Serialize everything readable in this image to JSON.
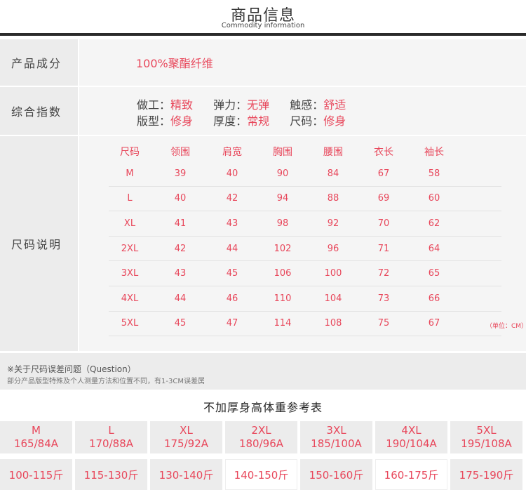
{
  "header": {
    "title": "商品信息",
    "subtitle": "Commodity information"
  },
  "composition": {
    "label": "产品成分",
    "value": "100%聚酯纤维"
  },
  "index": {
    "label": "综合指数",
    "line1": [
      {
        "key": "做工：",
        "val": "精致"
      },
      {
        "key": "弹力：",
        "val": "无弹"
      },
      {
        "key": "触感：",
        "val": "舒适"
      }
    ],
    "line2": [
      {
        "key": "版型：",
        "val": "修身"
      },
      {
        "key": "厚度：",
        "val": "常规"
      },
      {
        "key": "尺码：",
        "val": "修身"
      }
    ]
  },
  "size_chart": {
    "label": "尺码说明",
    "headers": [
      "尺码",
      "领围",
      "肩宽",
      "胸围",
      "腰围",
      "衣长",
      "袖长"
    ],
    "rows": [
      [
        "M",
        "39",
        "40",
        "90",
        "84",
        "67",
        "58"
      ],
      [
        "L",
        "40",
        "42",
        "94",
        "88",
        "69",
        "60"
      ],
      [
        "XL",
        "41",
        "43",
        "98",
        "92",
        "70",
        "62"
      ],
      [
        "2XL",
        "42",
        "44",
        "102",
        "96",
        "71",
        "64"
      ],
      [
        "3XL",
        "43",
        "45",
        "106",
        "100",
        "72",
        "65"
      ],
      [
        "4XL",
        "44",
        "46",
        "110",
        "104",
        "73",
        "66"
      ],
      [
        "5XL",
        "45",
        "47",
        "114",
        "108",
        "75",
        "67"
      ]
    ],
    "unit": "（单位：CM）"
  },
  "question": {
    "title": "※关于尺码误差问题（Question）",
    "text": "部分产品版型特殊及个人测量方法和位置不同，有1-3CM误差属"
  },
  "reference": {
    "title": "不加厚身高体重参考表",
    "items": [
      {
        "size": "M",
        "height": "165/84A",
        "weight": "100-115斤"
      },
      {
        "size": "L",
        "height": "170/88A",
        "weight": "115-130斤"
      },
      {
        "size": "XL",
        "height": "175/92A",
        "weight": "130-140斤"
      },
      {
        "size": "2XL",
        "height": "180/96A",
        "weight": "140-150斤"
      },
      {
        "size": "3XL",
        "height": "185/100A",
        "weight": "150-160斤"
      },
      {
        "size": "4XL",
        "height": "190/104A",
        "weight": "160-175斤"
      },
      {
        "size": "5XL",
        "height": "195/108A",
        "weight": "175-190斤"
      }
    ]
  }
}
